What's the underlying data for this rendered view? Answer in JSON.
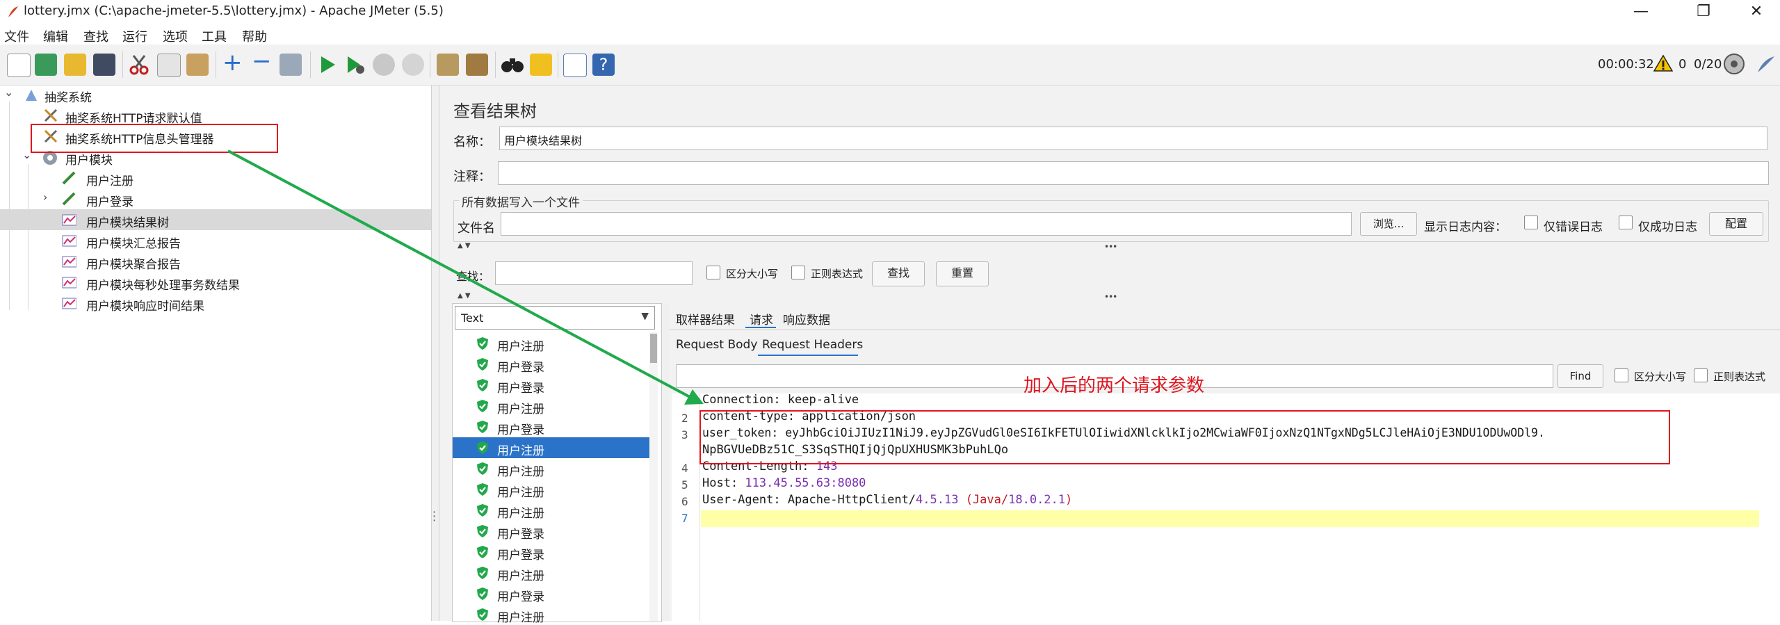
{
  "window": {
    "title": "lottery.jmx (C:\\apache-jmeter-5.5\\lottery.jmx) - Apache JMeter (5.5)",
    "minimize": "—",
    "maximize": "❐",
    "close": "✕"
  },
  "menu": [
    "文件",
    "编辑",
    "查找",
    "运行",
    "选项",
    "工具",
    "帮助"
  ],
  "status": {
    "elapsed": "00:00:32",
    "warnings": "0",
    "threads": "0/20"
  },
  "tree": {
    "root": "抽奖系统",
    "defaults": "抽奖系统HTTP请求默认值",
    "header_manager": "抽奖系统HTTP信息头管理器",
    "group": "用户模块",
    "items": [
      "用户注册",
      "用户登录",
      "用户模块结果树",
      "用户模块汇总报告",
      "用户模块聚合报告",
      "用户模块每秒处理事务数结果",
      "用户模块响应时间结果"
    ]
  },
  "panel": {
    "title": "查看结果树",
    "name_label": "名称：",
    "name_value": "用户模块结果树",
    "comment_label": "注释：",
    "comment_value": "",
    "file_section": "所有数据写入一个文件",
    "filename_label": "文件名",
    "filename_value": "",
    "browse": "浏览...",
    "log_label": "显示日志内容：",
    "errors_only": "仅错误日志",
    "success_only": "仅成功日志",
    "configure": "配置",
    "search_label": "查找：",
    "search_value": "",
    "case_sensitive": "区分大小写",
    "regex": "正则表达式",
    "find_btn": "查找",
    "reset_btn": "重置"
  },
  "results": {
    "renderer": "Text",
    "samples": [
      "用户注册",
      "用户登录",
      "用户登录",
      "用户注册",
      "用户登录",
      "用户注册",
      "用户注册",
      "用户注册",
      "用户注册",
      "用户登录",
      "用户登录",
      "用户注册",
      "用户登录",
      "用户注册"
    ],
    "selected_index": 5,
    "tabs": [
      "取样器结果",
      "请求",
      "响应数据"
    ],
    "active_tab": "请求",
    "subtabs": [
      "Request Body",
      "Request Headers"
    ],
    "active_subtab": "Request Headers",
    "find_value": "",
    "find_btn": "Find",
    "find_case": "区分大小写",
    "find_regex": "正则表达式"
  },
  "annotation": "加入后的两个请求参数",
  "headers": {
    "line_numbers": [
      "2",
      "3",
      "4",
      "5",
      "6",
      "7"
    ],
    "lines": {
      "l1": "Connection: keep-alive",
      "l2": "content-type: application/json",
      "l3a": "user_token: eyJhbGciOiJIUzI1NiJ9.eyJpZGVudGl0eSI6IkFETUlOIiwidXNlcklkIjo2MCwiaWF0IjoxNzQ1NTgxNDg5LCJleHAiOjE3NDU1ODUwODl9.",
      "l3b": "NpBGVUeDBz51C_S3SqSTHQIjQjQpUXHUSMK3bPuhLQo",
      "l4_key": "Content-Length: ",
      "l4_val": "143",
      "l5_key": "Host: ",
      "l5_val": "113.45.55.63:8080",
      "l6_key": "User-Agent: Apache-HttpClient/",
      "l6_ver": "4.5.13",
      "l6_mid": " (Java/",
      "l6_jv": "18.0.2.1",
      "l6_end": ")"
    }
  },
  "colors": {
    "selection": "#2b73c8",
    "annotation_red": "#e0141e",
    "arrow_green": "#1faa4b",
    "value_purple": "#7a2fb0"
  }
}
